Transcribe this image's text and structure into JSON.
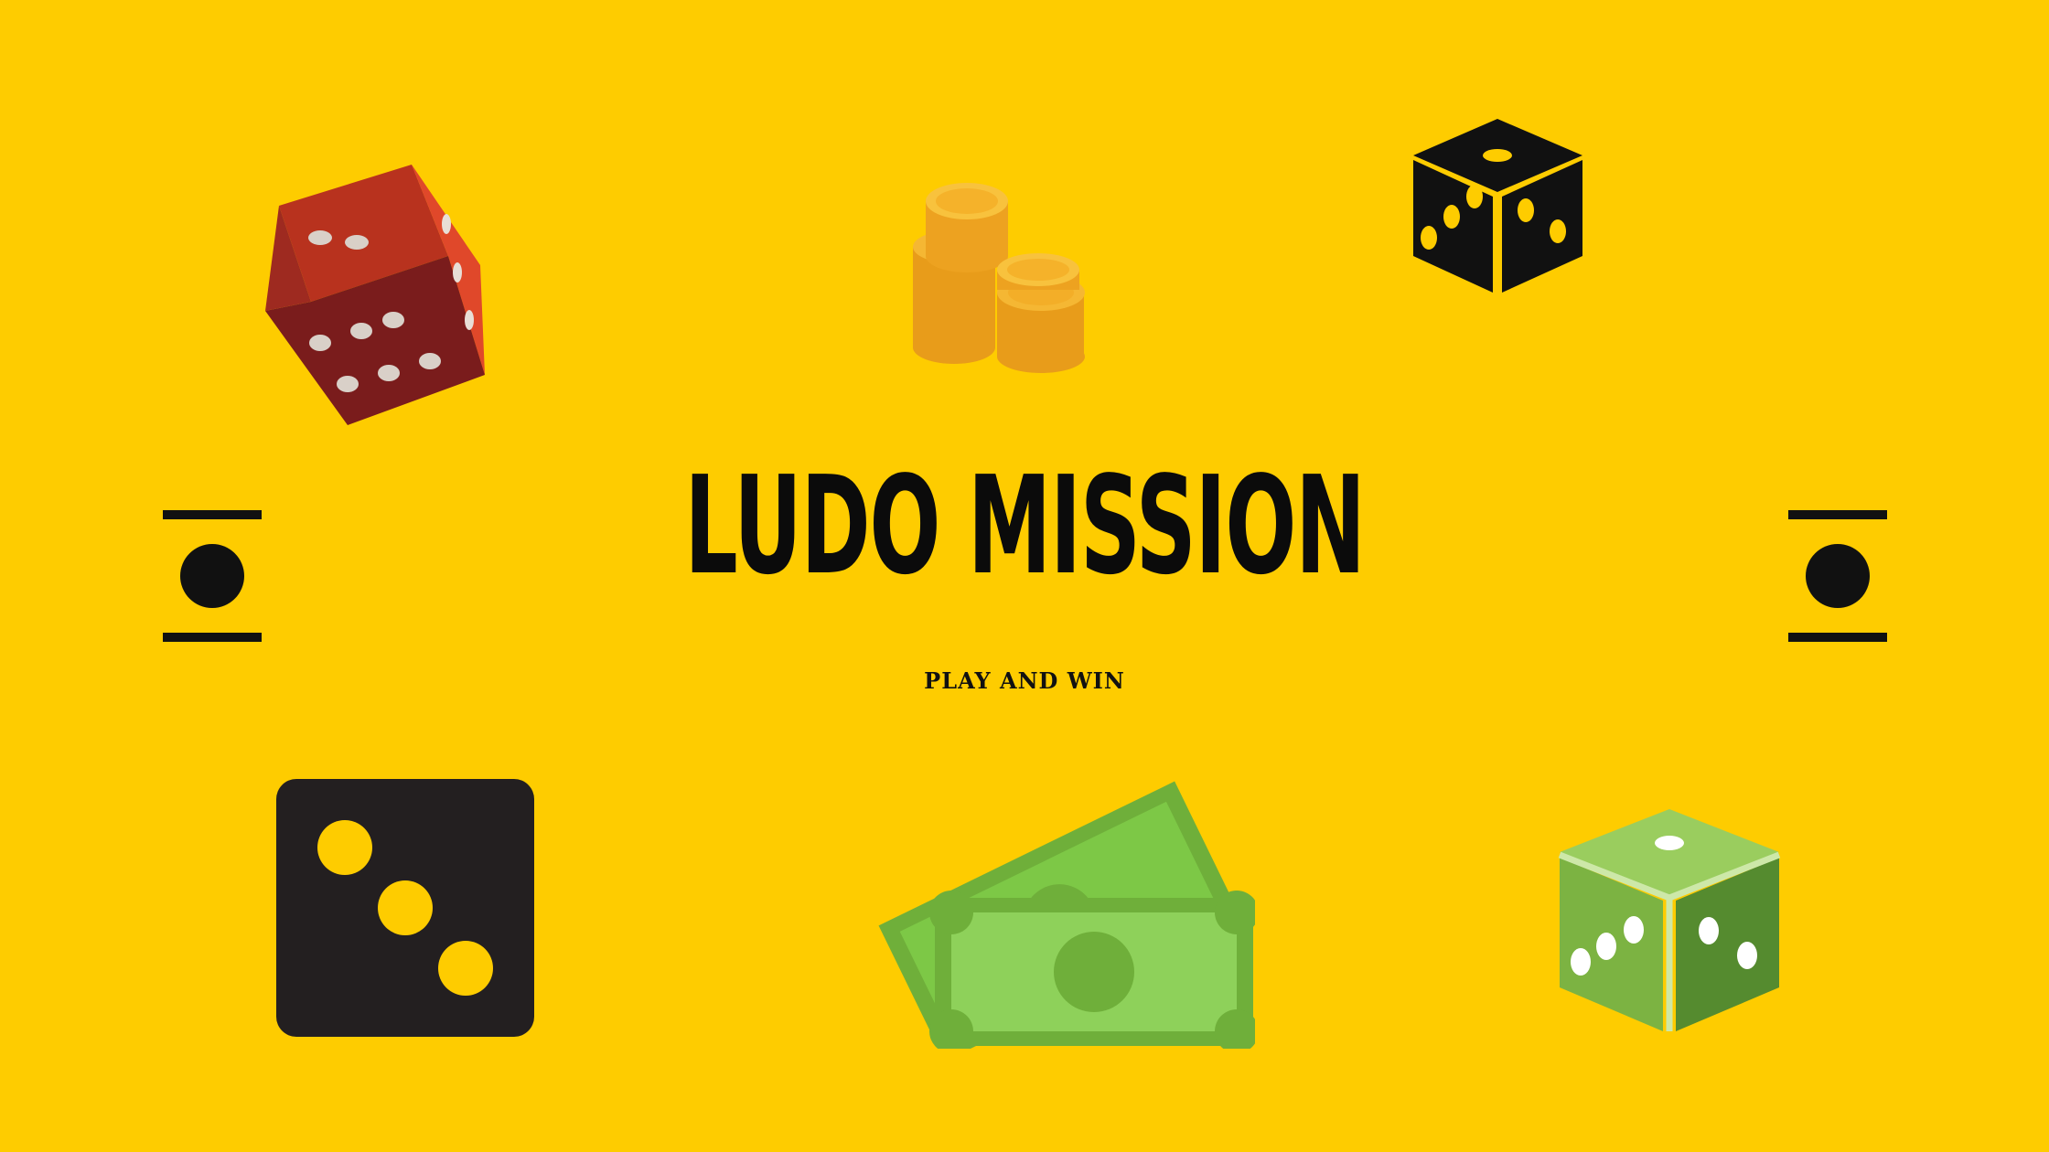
{
  "title": "LUDO MISSION",
  "subtitle": "PLAY AND WIN",
  "colors": {
    "background": "#FECC00",
    "text": "#0b0b0b",
    "red_die": "#8B1E1E",
    "black_die": "#231F20",
    "green_die": "#7CB342",
    "coin": "#F5A623",
    "cash": "#8BC34A"
  },
  "icons": {
    "red_die": "red-die-icon",
    "coins": "coin-stack-icon",
    "black_die_small": "black-3d-die-icon",
    "left_marker": "dot-marker-icon",
    "right_marker": "dot-marker-icon",
    "black_die_flat": "black-die-three-icon",
    "cash": "cash-bills-icon",
    "green_die": "green-3d-die-icon"
  }
}
